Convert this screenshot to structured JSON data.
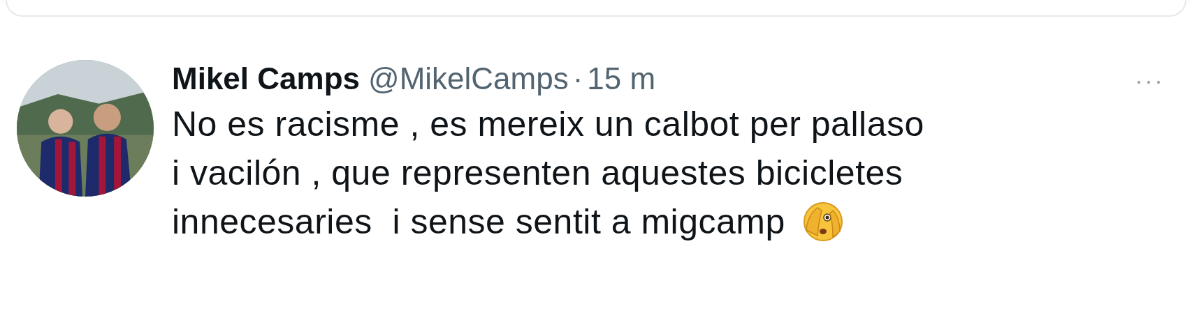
{
  "tweet": {
    "name": "Mikel Camps",
    "handle": "@MikelCamps",
    "separator": "·",
    "time": "15 m",
    "more": "···",
    "lines": [
      "No es racisme , es mereix un calbot per pallaso",
      "i vacilón , que representen aquestes bicicletes",
      "innecesaries  i sense sentit a migcamp"
    ]
  }
}
